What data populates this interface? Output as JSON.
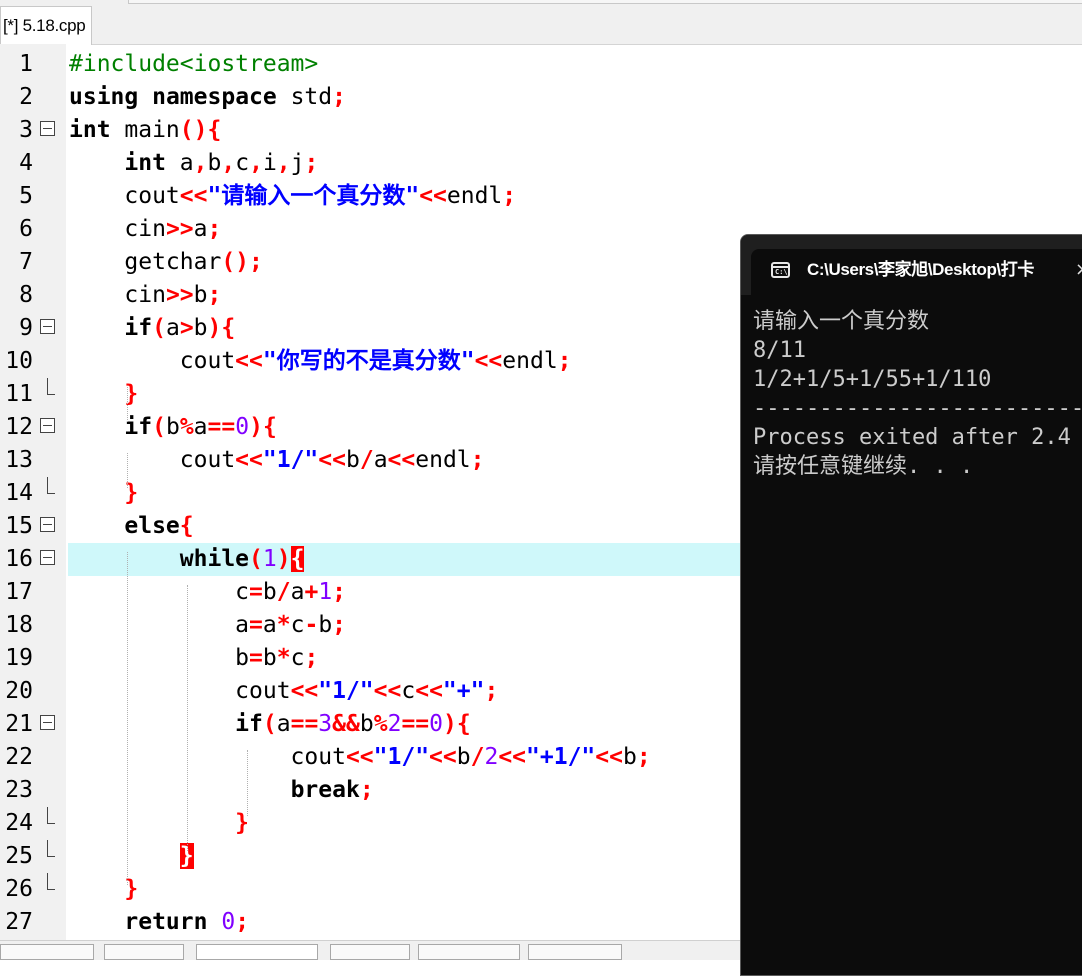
{
  "tab": {
    "label": "[*] 5.18.cpp"
  },
  "editor": {
    "active_line": 16,
    "lines": [
      {
        "n": "1",
        "fold": "",
        "tokens": [
          [
            "pp",
            "#include<iostream>"
          ]
        ]
      },
      {
        "n": "2",
        "fold": "",
        "tokens": [
          [
            "kw",
            "using"
          ],
          [
            "t",
            " "
          ],
          [
            "kw",
            "namespace"
          ],
          [
            "t",
            " std"
          ],
          [
            "op",
            ";"
          ]
        ]
      },
      {
        "n": "3",
        "fold": "box",
        "tokens": [
          [
            "kw",
            "int"
          ],
          [
            "t",
            " main"
          ],
          [
            "br",
            "(){"
          ]
        ]
      },
      {
        "n": "4",
        "fold": "",
        "tokens": [
          [
            "t",
            "    "
          ],
          [
            "kw",
            "int"
          ],
          [
            "t",
            " a"
          ],
          [
            "op",
            ","
          ],
          [
            "t",
            "b"
          ],
          [
            "op",
            ","
          ],
          [
            "t",
            "c"
          ],
          [
            "op",
            ","
          ],
          [
            "t",
            "i"
          ],
          [
            "op",
            ","
          ],
          [
            "t",
            "j"
          ],
          [
            "op",
            ";"
          ]
        ]
      },
      {
        "n": "5",
        "fold": "",
        "tokens": [
          [
            "t",
            "    cout"
          ],
          [
            "op",
            "<<"
          ],
          [
            "str",
            "\"请输入一个真分数\""
          ],
          [
            "op",
            "<<"
          ],
          [
            "t",
            "endl"
          ],
          [
            "op",
            ";"
          ]
        ]
      },
      {
        "n": "6",
        "fold": "",
        "tokens": [
          [
            "t",
            "    cin"
          ],
          [
            "op",
            ">>"
          ],
          [
            "t",
            "a"
          ],
          [
            "op",
            ";"
          ]
        ]
      },
      {
        "n": "7",
        "fold": "",
        "tokens": [
          [
            "t",
            "    getchar"
          ],
          [
            "br",
            "()"
          ],
          [
            "op",
            ";"
          ]
        ]
      },
      {
        "n": "8",
        "fold": "",
        "tokens": [
          [
            "t",
            "    cin"
          ],
          [
            "op",
            ">>"
          ],
          [
            "t",
            "b"
          ],
          [
            "op",
            ";"
          ]
        ]
      },
      {
        "n": "9",
        "fold": "box",
        "tokens": [
          [
            "t",
            "    "
          ],
          [
            "kw",
            "if"
          ],
          [
            "br",
            "("
          ],
          [
            "t",
            "a"
          ],
          [
            "op",
            ">"
          ],
          [
            "t",
            "b"
          ],
          [
            "br",
            "){"
          ]
        ]
      },
      {
        "n": "10",
        "fold": "",
        "tokens": [
          [
            "t",
            "        cout"
          ],
          [
            "op",
            "<<"
          ],
          [
            "str",
            "\"你写的不是真分数\""
          ],
          [
            "op",
            "<<"
          ],
          [
            "t",
            "endl"
          ],
          [
            "op",
            ";"
          ]
        ]
      },
      {
        "n": "11",
        "fold": "end",
        "tokens": [
          [
            "t",
            "    "
          ],
          [
            "br",
            "}"
          ]
        ]
      },
      {
        "n": "12",
        "fold": "box",
        "tokens": [
          [
            "t",
            "    "
          ],
          [
            "kw",
            "if"
          ],
          [
            "br",
            "("
          ],
          [
            "t",
            "b"
          ],
          [
            "op",
            "%"
          ],
          [
            "t",
            "a"
          ],
          [
            "op",
            "=="
          ],
          [
            "num",
            "0"
          ],
          [
            "br",
            "){"
          ]
        ]
      },
      {
        "n": "13",
        "fold": "",
        "tokens": [
          [
            "t",
            "        cout"
          ],
          [
            "op",
            "<<"
          ],
          [
            "str",
            "\"1/\""
          ],
          [
            "op",
            "<<"
          ],
          [
            "t",
            "b"
          ],
          [
            "op",
            "/"
          ],
          [
            "t",
            "a"
          ],
          [
            "op",
            "<<"
          ],
          [
            "t",
            "endl"
          ],
          [
            "op",
            ";"
          ]
        ]
      },
      {
        "n": "14",
        "fold": "end",
        "tokens": [
          [
            "t",
            "    "
          ],
          [
            "br",
            "}"
          ]
        ]
      },
      {
        "n": "15",
        "fold": "box",
        "tokens": [
          [
            "t",
            "    "
          ],
          [
            "kw",
            "else"
          ],
          [
            "br",
            "{"
          ]
        ]
      },
      {
        "n": "16",
        "fold": "box",
        "tokens": [
          [
            "t",
            "        "
          ],
          [
            "kw",
            "while"
          ],
          [
            "br",
            "("
          ],
          [
            "num",
            "1"
          ],
          [
            "br",
            ")"
          ],
          [
            "brm",
            "{"
          ]
        ]
      },
      {
        "n": "17",
        "fold": "",
        "tokens": [
          [
            "t",
            "            c"
          ],
          [
            "op",
            "="
          ],
          [
            "t",
            "b"
          ],
          [
            "op",
            "/"
          ],
          [
            "t",
            "a"
          ],
          [
            "op",
            "+"
          ],
          [
            "num",
            "1"
          ],
          [
            "op",
            ";"
          ]
        ]
      },
      {
        "n": "18",
        "fold": "",
        "tokens": [
          [
            "t",
            "            a"
          ],
          [
            "op",
            "="
          ],
          [
            "t",
            "a"
          ],
          [
            "op",
            "*"
          ],
          [
            "t",
            "c"
          ],
          [
            "op",
            "-"
          ],
          [
            "t",
            "b"
          ],
          [
            "op",
            ";"
          ]
        ]
      },
      {
        "n": "19",
        "fold": "",
        "tokens": [
          [
            "t",
            "            b"
          ],
          [
            "op",
            "="
          ],
          [
            "t",
            "b"
          ],
          [
            "op",
            "*"
          ],
          [
            "t",
            "c"
          ],
          [
            "op",
            ";"
          ]
        ]
      },
      {
        "n": "20",
        "fold": "",
        "tokens": [
          [
            "t",
            "            cout"
          ],
          [
            "op",
            "<<"
          ],
          [
            "str",
            "\"1/\""
          ],
          [
            "op",
            "<<"
          ],
          [
            "t",
            "c"
          ],
          [
            "op",
            "<<"
          ],
          [
            "str",
            "\"+\""
          ],
          [
            "op",
            ";"
          ]
        ]
      },
      {
        "n": "21",
        "fold": "box",
        "tokens": [
          [
            "t",
            "            "
          ],
          [
            "kw",
            "if"
          ],
          [
            "br",
            "("
          ],
          [
            "t",
            "a"
          ],
          [
            "op",
            "=="
          ],
          [
            "num",
            "3"
          ],
          [
            "op",
            "&&"
          ],
          [
            "t",
            "b"
          ],
          [
            "op",
            "%"
          ],
          [
            "num",
            "2"
          ],
          [
            "op",
            "=="
          ],
          [
            "num",
            "0"
          ],
          [
            "br",
            "){"
          ]
        ]
      },
      {
        "n": "22",
        "fold": "",
        "tokens": [
          [
            "t",
            "                cout"
          ],
          [
            "op",
            "<<"
          ],
          [
            "str",
            "\"1/\""
          ],
          [
            "op",
            "<<"
          ],
          [
            "t",
            "b"
          ],
          [
            "op",
            "/"
          ],
          [
            "num",
            "2"
          ],
          [
            "op",
            "<<"
          ],
          [
            "str",
            "\"+1/\""
          ],
          [
            "op",
            "<<"
          ],
          [
            "t",
            "b"
          ],
          [
            "op",
            ";"
          ]
        ]
      },
      {
        "n": "23",
        "fold": "",
        "tokens": [
          [
            "t",
            "                "
          ],
          [
            "kw",
            "break"
          ],
          [
            "op",
            ";"
          ]
        ]
      },
      {
        "n": "24",
        "fold": "end",
        "tokens": [
          [
            "t",
            "            "
          ],
          [
            "br",
            "}"
          ]
        ]
      },
      {
        "n": "25",
        "fold": "end",
        "tokens": [
          [
            "t",
            "        "
          ],
          [
            "brm",
            "}"
          ]
        ]
      },
      {
        "n": "26",
        "fold": "end",
        "tokens": [
          [
            "t",
            "    "
          ],
          [
            "br",
            "}"
          ]
        ]
      },
      {
        "n": "27",
        "fold": "",
        "tokens": [
          [
            "t",
            "    "
          ],
          [
            "kw",
            "return"
          ],
          [
            "t",
            " "
          ],
          [
            "num",
            "0"
          ],
          [
            "op",
            ";"
          ]
        ]
      }
    ]
  },
  "console": {
    "title": "C:\\Users\\李家旭\\Desktop\\打卡",
    "close_glyph": "×",
    "icon": "cmd-icon",
    "icon_text": "C:\\",
    "output": [
      "请输入一个真分数",
      "8/11",
      "1/2+1/5+1/55+1/110",
      "------------------------------",
      "Process exited after 2.4",
      "请按任意键继续. . ."
    ]
  }
}
